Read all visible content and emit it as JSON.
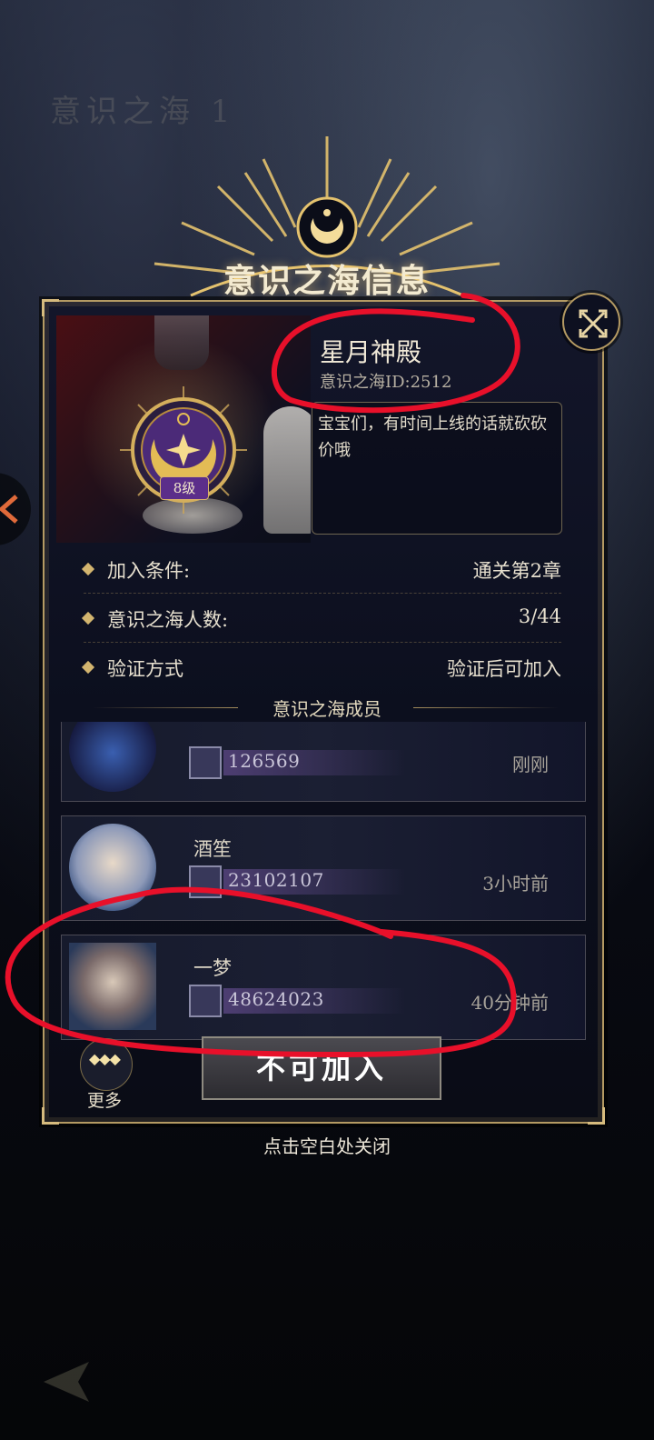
{
  "background": {
    "ghost_text": "意识之海 1"
  },
  "header": {
    "title": "意识之海信息"
  },
  "icons": {
    "close": "close-x-icon",
    "emblem": "crescent-moon-star-emblem",
    "power": "crossed-swords-icon",
    "more": "three-diamonds-icon",
    "back": "back-arrow-icon"
  },
  "guild": {
    "name": "星月神殿",
    "id_text": "意识之海ID:2512",
    "level_badge": "8级",
    "description": "宝宝们，有时间上线的话就砍砍价哦"
  },
  "info_rows": [
    {
      "label": "加入条件:",
      "value": "通关第2章"
    },
    {
      "label": "意识之海人数:",
      "value": "3/44"
    },
    {
      "label": "验证方式",
      "value": "验证后可加入"
    }
  ],
  "members_section": {
    "title": "意识之海成员"
  },
  "members": [
    {
      "name": "",
      "power": "126569",
      "time": "刚刚"
    },
    {
      "name": "酒笙",
      "power": "23102107",
      "time": "3小时前"
    },
    {
      "name": "一梦",
      "power": "48624023",
      "time": "40分钟前"
    }
  ],
  "actions": {
    "join_button": "不可加入",
    "more_label": "更多",
    "more_icon_text": "◆◆◆"
  },
  "footer": {
    "close_hint": "点击空白处关闭"
  },
  "colors": {
    "gold": "#b49a63",
    "panel_bg": "#0c0f1e",
    "annotation_red": "#e8102a",
    "level_badge_purple": "#5b2e8a"
  }
}
